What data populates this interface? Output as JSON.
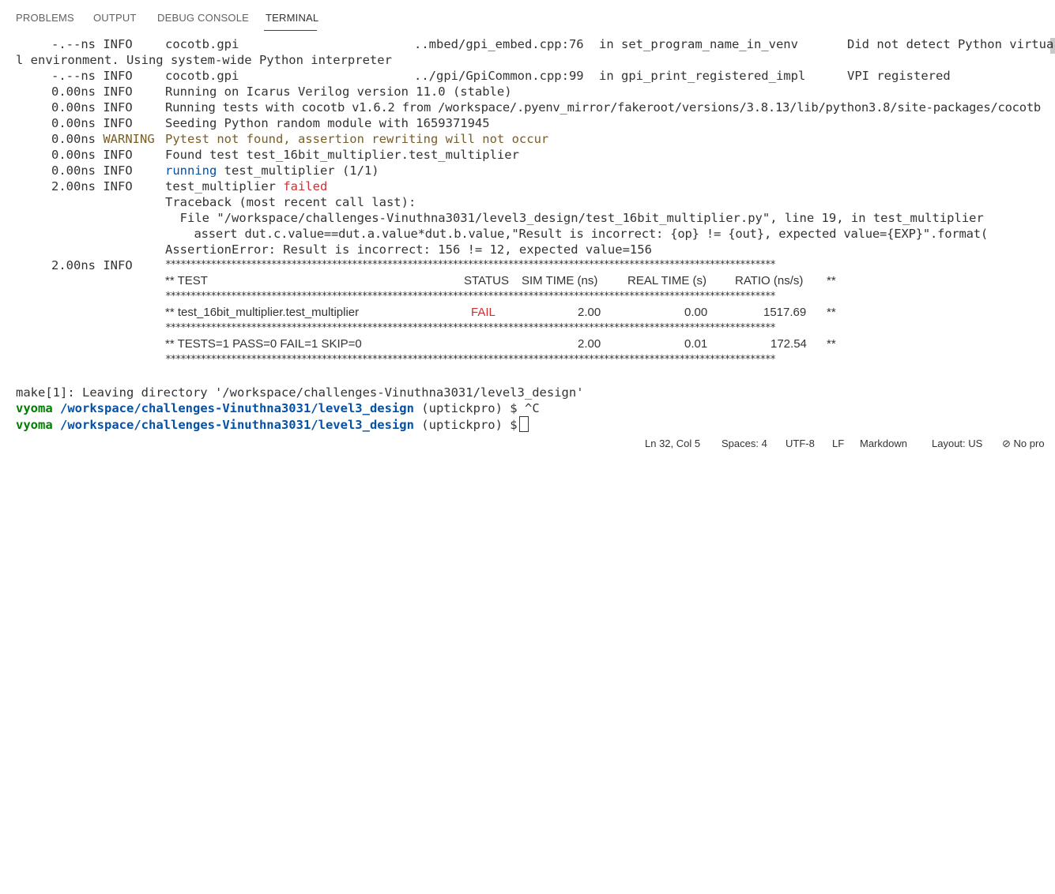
{
  "panel_tabs": [
    "PROBLEMS",
    "OUTPUT",
    "DEBUG CONSOLE",
    "TERMINAL"
  ],
  "log": [
    {
      "time": "-.--ns",
      "level": "INFO",
      "source": "cocotb.gpi",
      "file": "..mbed/gpi_embed.cpp:76",
      "func": "in set_program_name_in_venv",
      "msg": "Did not detect Python virtua"
    },
    {
      "wrap": "l environment. Using system-wide Python interpreter"
    },
    {
      "time": "-.--ns",
      "level": "INFO",
      "source": "cocotb.gpi",
      "file": "../gpi/GpiCommon.cpp:99",
      "func": "in gpi_print_registered_impl",
      "msg": "VPI registered"
    },
    {
      "time": "0.00ns",
      "level": "INFO",
      "msg": "Running on Icarus Verilog version 11.0 (stable)"
    },
    {
      "time": "0.00ns",
      "level": "INFO",
      "msg": "Running tests with cocotb v1.6.2 from /workspace/.pyenv_mirror/fakeroot/versions/3.8.13/lib/python3.8/site-packages/cocotb"
    },
    {
      "time": "0.00ns",
      "level": "INFO",
      "msg": "Seeding Python random module with 1659371945"
    },
    {
      "time": "0.00ns",
      "level": "WARNING",
      "msg": "Pytest not found, assertion rewriting will not occur"
    },
    {
      "time": "0.00ns",
      "level": "INFO",
      "msg": "Found test test_16bit_multiplier.test_multiplier"
    },
    {
      "time": "0.00ns",
      "level": "INFO",
      "msg_a": "running",
      "msg_b": " test_multiplier (1/1)"
    },
    {
      "time": "2.00ns",
      "level": "INFO",
      "msg_a": "test_multiplier ",
      "msg_b": "failed"
    }
  ],
  "traceback": [
    "Traceback (most recent call last):",
    "  File \"/workspace/challenges-Vinuthna3031/level3_design/test_16bit_multiplier.py\", line 19, in test_multiplier",
    "    assert dut.c.value==dut.a.value*dut.b.value,\"Result is incorrect: {op} != {out}, expected value={EXP}\".format(",
    "AssertionError: Result is incorrect: 156 != 12, expected value=156"
  ],
  "summary": {
    "time": "2.00ns",
    "level": "INFO",
    "stars": "*************************************************************************************************************************",
    "header": {
      "test": "** TEST",
      "status": "STATUS",
      "sim": "SIM TIME (ns)",
      "real": "REAL TIME (s)",
      "ratio": "RATIO (ns/s)",
      "end": "**"
    },
    "row": {
      "test": "** test_16bit_multiplier.test_multiplier",
      "status": "FAIL",
      "sim": "2.00",
      "real": "0.00",
      "ratio": "1517.69",
      "end": "**"
    },
    "total": {
      "test": "** TESTS=1 PASS=0 FAIL=1 SKIP=0",
      "sim": "2.00",
      "real": "0.01",
      "ratio": "172.54",
      "end": "**"
    }
  },
  "make_line": "make[1]: Leaving directory '/workspace/challenges-Vinuthna3031/level3_design'",
  "prompt": {
    "user": "vyoma",
    "path": "/workspace/challenges-Vinuthna3031/level3_design",
    "branch": "(uptickpro)",
    "symbol": "$",
    "line1_input": "^C"
  },
  "status_bar": {
    "position": "Ln 32, Col 5",
    "spaces": "Spaces: 4",
    "encoding": "UTF-8",
    "eol": "LF",
    "language": "Markdown",
    "layout": "Layout: US",
    "problems": "No pro"
  },
  "colors": {
    "warning": "#795e26",
    "error": "#cd3131",
    "info_blue": "#0451a5",
    "prompt_user": "#008000"
  }
}
